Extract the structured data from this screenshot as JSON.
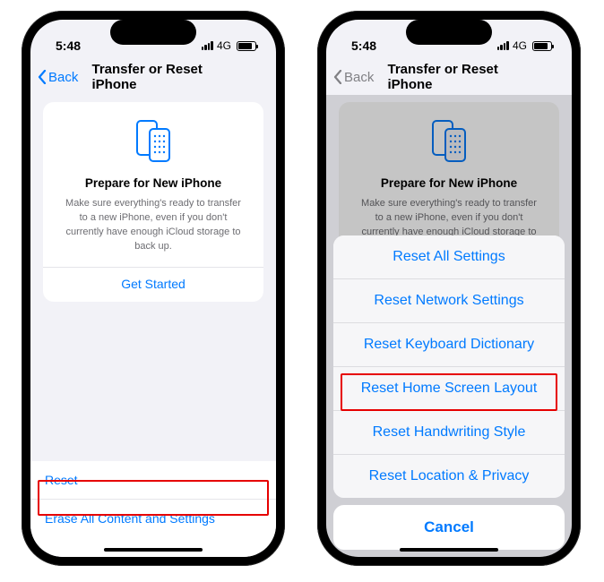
{
  "status": {
    "time": "5:48",
    "network": "4G"
  },
  "nav": {
    "back": "Back",
    "title": "Transfer or Reset iPhone"
  },
  "card": {
    "heading": "Prepare for New iPhone",
    "body": "Make sure everything's ready to transfer to a new iPhone, even if you don't currently have enough iCloud storage to back up.",
    "cta": "Get Started"
  },
  "list": {
    "reset": "Reset",
    "erase": "Erase All Content and Settings"
  },
  "sheet": {
    "options": [
      "Reset All Settings",
      "Reset Network Settings",
      "Reset Keyboard Dictionary",
      "Reset Home Screen Layout",
      "Reset Handwriting Style",
      "Reset Location & Privacy"
    ],
    "cancel": "Cancel"
  },
  "colors": {
    "accent": "#007aff",
    "highlight": "#e60000"
  }
}
